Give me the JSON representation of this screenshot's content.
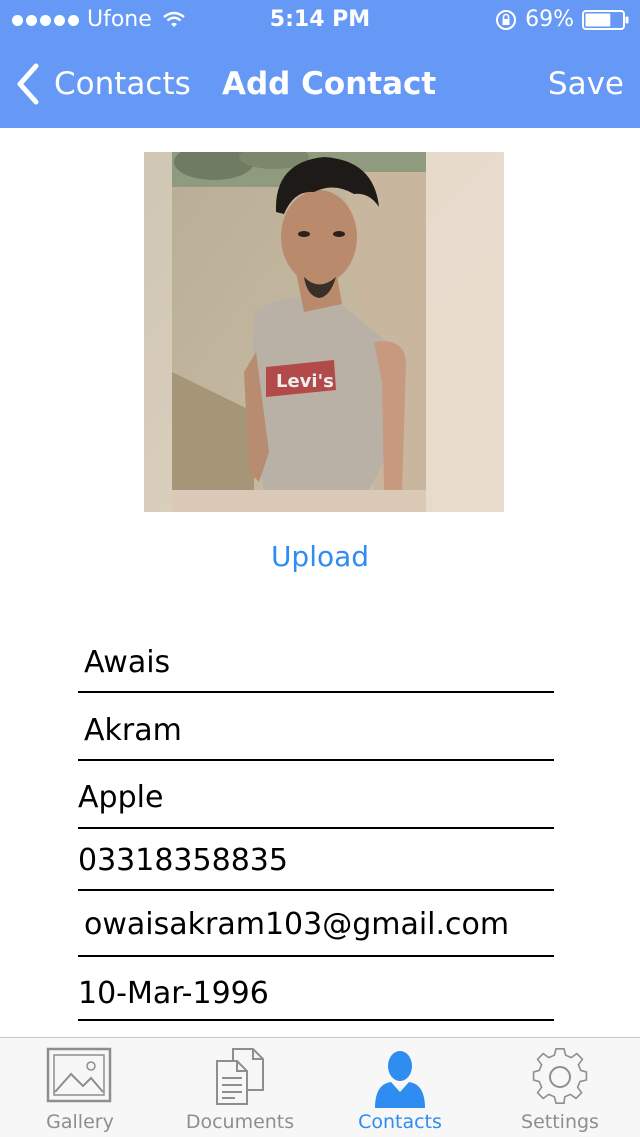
{
  "status_bar": {
    "carrier": "Ufone",
    "time": "5:14 PM",
    "battery_percent": "69%",
    "battery_level": 0.69
  },
  "nav": {
    "back_label": "Contacts",
    "title": "Add Contact",
    "save_label": "Save"
  },
  "photo": {
    "shirt_text": "Levi's"
  },
  "upload_label": "Upload",
  "form": {
    "first_name": "Awais",
    "last_name": "Akram",
    "company": "Apple",
    "phone": "03318358835",
    "email": "owaisakram103@gmail.com",
    "birthday": "10-Mar-1996"
  },
  "tabs": [
    {
      "label": "Gallery",
      "icon": "gallery-icon",
      "active": false
    },
    {
      "label": "Documents",
      "icon": "documents-icon",
      "active": false
    },
    {
      "label": "Contacts",
      "icon": "contacts-icon",
      "active": true
    },
    {
      "label": "Settings",
      "icon": "settings-icon",
      "active": false
    }
  ],
  "colors": {
    "header": "#6699f5",
    "accent": "#2f8cf0",
    "tab_inactive": "#8e8e8e"
  }
}
